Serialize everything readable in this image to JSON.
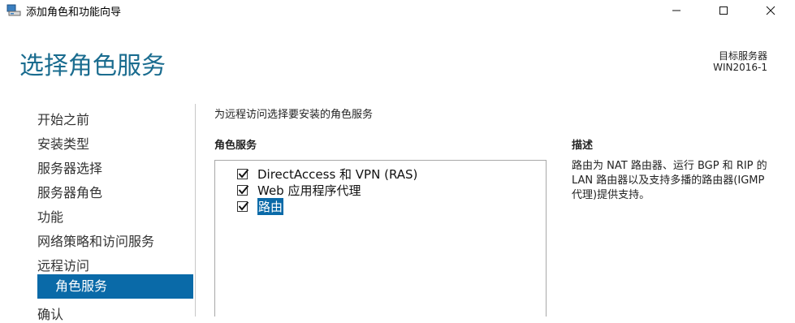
{
  "window": {
    "title": "添加角色和功能向导",
    "app_icon": "server-manager-icon"
  },
  "header": {
    "title": "选择角色服务",
    "destination_label": "目标服务器",
    "destination_value": "WIN2016-1"
  },
  "nav": {
    "items": [
      {
        "label": "开始之前"
      },
      {
        "label": "安装类型"
      },
      {
        "label": "服务器选择"
      },
      {
        "label": "服务器角色"
      },
      {
        "label": "功能"
      },
      {
        "label": "网络策略和访问服务"
      },
      {
        "label": "远程访问"
      },
      {
        "label": "角色服务",
        "active": true
      },
      {
        "label": "确认"
      }
    ]
  },
  "main": {
    "instruction": "为远程访问选择要安装的角色服务",
    "section_title": "角色服务",
    "services": [
      {
        "label": "DirectAccess 和 VPN (RAS)",
        "checked": true
      },
      {
        "label": "Web 应用程序代理",
        "checked": true
      },
      {
        "label": "路由",
        "checked": true,
        "selected": true
      }
    ]
  },
  "description": {
    "title": "描述",
    "text": "路由为 NAT 路由器、运行 BGP 和 RIP 的 LAN 路由器以及支持多播的路由器(IGMP 代理)提供支持。"
  },
  "colors": {
    "accent": "#0a6aa8",
    "title": "#1a6c8f"
  }
}
